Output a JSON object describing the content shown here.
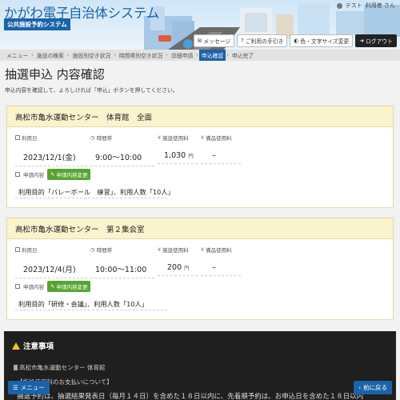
{
  "header": {
    "app_title": "かがわ電子自治体システム",
    "app_subtitle": "公共施設予約システム",
    "user_label": "テスト",
    "user_suffix": "利用者 さん",
    "buttons": [
      {
        "label": "メッセージ",
        "icon": "message-icon"
      },
      {
        "label": "ご利用の手引き",
        "icon": "guide-icon"
      },
      {
        "label": "色・文字サイズ変更",
        "icon": "palette-icon"
      },
      {
        "label": "ログアウト",
        "icon": "logout-icon"
      }
    ]
  },
  "breadcrumb": [
    "メニュー",
    "施設の検索",
    "施設別空き状況",
    "時間帯別空き状況",
    "詳細申請",
    "申込確認",
    "申込完了"
  ],
  "breadcrumb_active_index": 5,
  "page": {
    "title": "抽選申込 内容確認",
    "intro": "申込内容を確認して、よろしければ「申込」ボタンを押してください。"
  },
  "labels": {
    "date": "利用日",
    "time": "時間帯",
    "fee": "施設使用料",
    "equip_fee": "備品使用料",
    "request": "申請内容",
    "change": "申請内容変更",
    "yen_mark": "¥",
    "yen_unit": "円"
  },
  "bookings": [
    {
      "facility": "高松市亀水運動センター　体育館　全面",
      "date": "2023/12/1(金)",
      "time": "9:00～10:00",
      "fee": "1,030",
      "equip_fee": "–",
      "request_text": "利用目的「バレーボール　練習」、利用人数「10人」"
    },
    {
      "facility": "高松市亀水運動センター　第２集会室",
      "date": "2023/12/4(月)",
      "time": "10:00～11:00",
      "fee": "200",
      "equip_fee": "–",
      "request_text": "利用目的「研修・会議」、利用人数「10人」"
    }
  ],
  "notice": {
    "title": "注意事項",
    "facility": "高松市亀水運動センター 体育館",
    "line2": "【施設使用料のお支払いについて】",
    "line3": "抽選予約は、抽選結果発表日（毎月１４日）を含めた１８日以内に、先着順予約は、お申込日を含めた１８日以内"
  },
  "footer": {
    "menu_label": "メニュー",
    "back_label": "前に戻る"
  },
  "colors": {
    "accent": "#1a63a8",
    "change_button": "#55a532",
    "card_header": "#fbf3cd"
  }
}
